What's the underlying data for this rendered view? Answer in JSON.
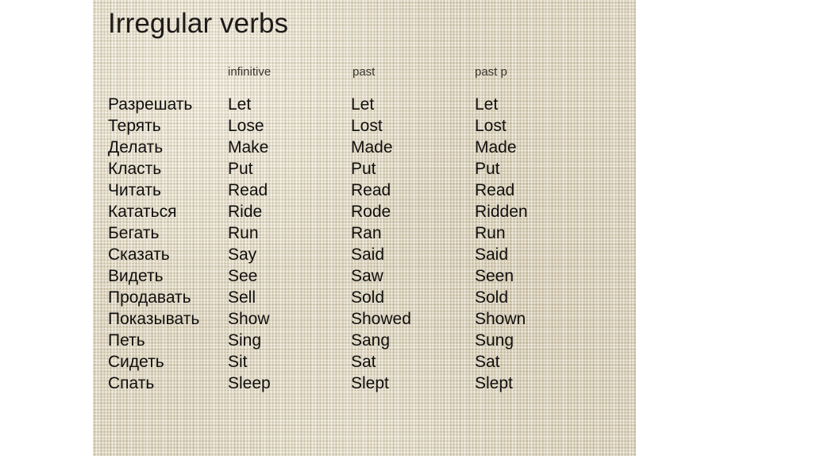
{
  "slide": {
    "title": "Irregular verbs",
    "background_color": "#ded5bf",
    "page_background_color": "#ffffff",
    "text_color": "#100f0d"
  },
  "table": {
    "headers": {
      "translation": "",
      "infinitive": "infinitive",
      "past": "past",
      "past_participle": "past p"
    },
    "rows": [
      {
        "translation": "Разрешать",
        "infinitive": "Let",
        "past": "Let",
        "past_participle": "Let"
      },
      {
        "translation": "Терять",
        "infinitive": "Lose",
        "past": "Lost",
        "past_participle": "Lost"
      },
      {
        "translation": "Делать",
        "infinitive": "Make",
        "past": "Made",
        "past_participle": "Made"
      },
      {
        "translation": "Класть",
        "infinitive": "Put",
        "past": "Put",
        "past_participle": "Put"
      },
      {
        "translation": "Читать",
        "infinitive": "Read",
        "past": "Read",
        "past_participle": "Read"
      },
      {
        "translation": "Кататься",
        "infinitive": "Ride",
        "past": "Rode",
        "past_participle": "Ridden"
      },
      {
        "translation": "Бегать",
        "infinitive": "Run",
        "past": "Ran",
        "past_participle": "Run"
      },
      {
        "translation": "Сказать",
        "infinitive": "Say",
        "past": "Said",
        "past_participle": "Said"
      },
      {
        "translation": "Видеть",
        "infinitive": "See",
        "past": "Saw",
        "past_participle": "Seen"
      },
      {
        "translation": "Продавать",
        "infinitive": "Sell",
        "past": "Sold",
        "past_participle": "Sold"
      },
      {
        "translation": "Показывать",
        "infinitive": "Show",
        "past": "Showed",
        "past_participle": "Shown"
      },
      {
        "translation": "Петь",
        "infinitive": "Sing",
        "past": "Sang",
        "past_participle": "Sung"
      },
      {
        "translation": "Сидеть",
        "infinitive": "Sit",
        "past": "Sat",
        "past_participle": "Sat"
      },
      {
        "translation": "Спать",
        "infinitive": "Sleep",
        "past": "Slept",
        "past_participle": "Slept"
      }
    ]
  }
}
